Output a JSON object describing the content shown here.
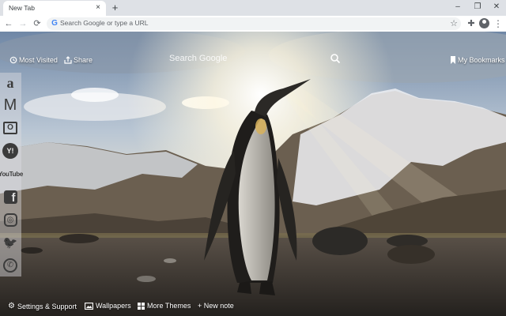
{
  "browser": {
    "tab_title": "New Tab",
    "tab_close": "×",
    "new_tab": "+",
    "window_controls": {
      "minimize": "–",
      "maximize": "❐",
      "close": "✕"
    },
    "nav": {
      "back": "←",
      "forward": "→",
      "reload": "⟳"
    },
    "omnibox_placeholder": "Search Google or type a URL",
    "star": "☆",
    "extensions": "✚",
    "menu": "⋮"
  },
  "header": {
    "most_visited": "Most Visited",
    "share": "Share",
    "search_placeholder": "Search Google",
    "bookmarks": "My Bookmarks"
  },
  "dock": [
    {
      "name": "amazon",
      "icon": "amazon-icon",
      "glyph": "a"
    },
    {
      "name": "gmail",
      "icon": "gmail-icon",
      "glyph": "M"
    },
    {
      "name": "outlook",
      "icon": "outlook-icon",
      "glyph": "O"
    },
    {
      "name": "yahoo",
      "icon": "yahoo-icon",
      "glyph": "Y!"
    },
    {
      "name": "youtube",
      "icon": "youtube-icon",
      "glyph": "YouTube"
    },
    {
      "name": "facebook",
      "icon": "facebook-icon",
      "glyph": "f"
    },
    {
      "name": "instagram",
      "icon": "instagram-icon",
      "glyph": "◎"
    },
    {
      "name": "twitter",
      "icon": "twitter-icon",
      "glyph": "🐦"
    },
    {
      "name": "whatsapp",
      "icon": "whatsapp-icon",
      "glyph": "✆"
    }
  ],
  "footer": {
    "settings": "Settings & Support",
    "wallpapers": "Wallpapers",
    "themes": "More Themes",
    "note": "+ New note"
  },
  "colors": {
    "tabstrip": "#dee1e6",
    "omnibox": "#f1f3f4",
    "accent": "#4285f4"
  }
}
